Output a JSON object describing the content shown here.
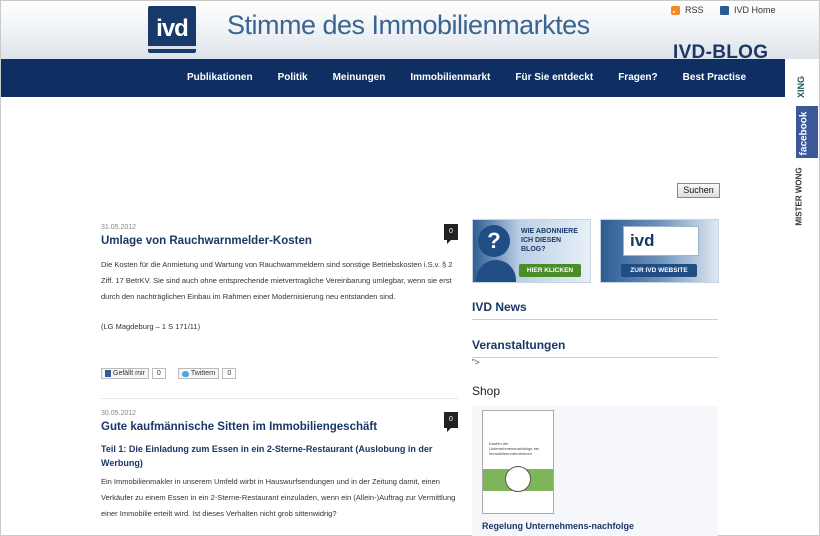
{
  "header": {
    "logo_text": "ivd",
    "site_title": "Stimme des Immobilienmarktes",
    "blog_label": "IVD-BLOG",
    "links": [
      {
        "label": "RSS",
        "icon": "rss-icon"
      },
      {
        "label": "IVD Home",
        "icon": "home-icon"
      }
    ]
  },
  "nav": {
    "items": [
      "Publikationen",
      "Politik",
      "Meinungen",
      "Immobilienmarkt",
      "Für Sie entdeckt",
      "Fragen?",
      "Best Practise"
    ]
  },
  "social": {
    "xing": "XING",
    "facebook": "facebook",
    "misterwong": "MISTER WONG"
  },
  "search": {
    "button_label": "Suchen"
  },
  "posts": [
    {
      "date": "31.05.2012",
      "title": "Umlage von Rauchwarnmelder-Kosten",
      "comments": "0",
      "body": "Die Kosten für die Anmietung und Wartung von Rauchwarnmeldern sind sonstige Betriebskosten i.S.v. § 2 Ziff. 17 BetrKV. Sie sind auch ohne entsprechende mietvertragliche Vereinbarung umlegbar, wenn sie erst durch den nachträglichen Einbau im Rahmen einer Modernisierung neu entstanden sind.",
      "citation": "(LG Magdeburg – 1 S 171/11)",
      "share": {
        "facebook_label": "Gefällt mir",
        "facebook_count": "0",
        "twitter_label": "Twittern",
        "twitter_count": "0"
      }
    },
    {
      "date": "30.05.2012",
      "title": "Gute kaufmännische Sitten im Immobiliengeschäft",
      "comments": "0",
      "subtitle": "Teil 1: Die Einladung zum Essen in ein 2-Sterne-Restaurant (Auslobung in der Werbung)",
      "body": "Ein Immobilienmakler in unserem Umfeld wirbt in Hauswurfsendungen und in der Zeitung damit, einen Verkäufer zu einem Essen in ein 2-Sterne-Restaurant einzuladen, wenn ein (Allein-)Auftrag zur Vermittlung einer Immobilie erteilt wird. Ist dieses Verhalten nicht grob sittenwidrig?"
    }
  ],
  "sidebar": {
    "promo_abo": {
      "text": "WIE ABONNIERE ICH DIESEN BLOG?",
      "button": "HIER KLICKEN"
    },
    "promo_ivd": {
      "mini_logo": "ivd",
      "button": "ZUR IVD WEBSITE"
    },
    "ivd_news": "IVD News",
    "veranstaltungen": "Veranstaltungen",
    "veranstaltungen_text": "\">",
    "shop": "Shop",
    "book_cover_text": "Kaufen der Unternehmensnachfolge bei Immobilienunternehmen",
    "book_caption": "Regelung Unternehmens-nachfolge"
  },
  "colors": {
    "nav_bg": "#0f2f63",
    "title_blue": "#1b3766",
    "header_title": "#3b6590",
    "facebook": "#3b5998"
  }
}
